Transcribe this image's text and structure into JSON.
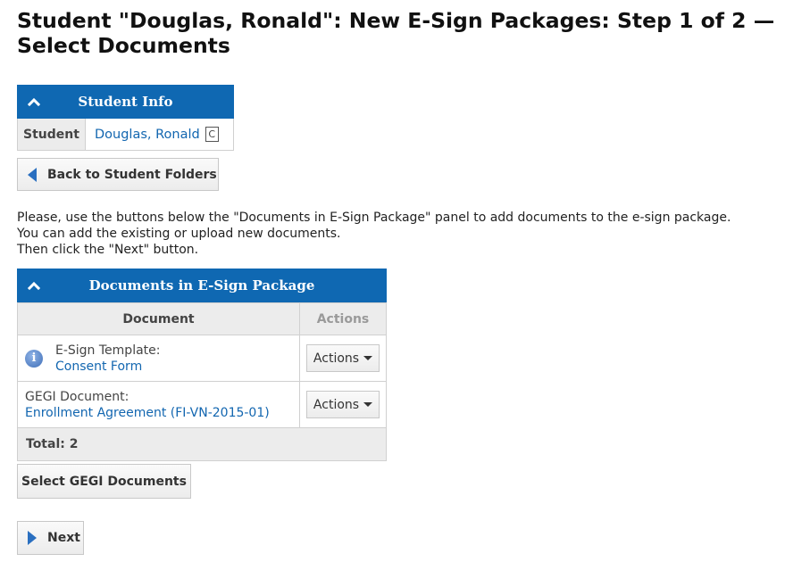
{
  "page": {
    "title": "Student \"Douglas, Ronald\": New E-Sign Packages: Step 1 of 2 — Select Documents"
  },
  "student_panel": {
    "header": "Student Info",
    "collapse_icon": "chevron-up-icon",
    "student_label": "Student",
    "student_name": "Douglas, Ronald",
    "badge": "C"
  },
  "back_button": {
    "label": "Back to Student Folders",
    "icon": "arrow-left-icon"
  },
  "instructions": {
    "line1": "Please, use the buttons below the \"Documents in E-Sign Package\" panel to add documents to the e-sign package.",
    "line2": "You can add the existing or upload new documents.",
    "line3": "Then click the \"Next\" button."
  },
  "documents_panel": {
    "header": "Documents in E-Sign Package",
    "collapse_icon": "chevron-up-icon",
    "columns": {
      "document": "Document",
      "actions": "Actions"
    },
    "rows": [
      {
        "icon": "info-icon",
        "type": "E-Sign Template:",
        "name": "Consent Form",
        "actions_label": "Actions"
      },
      {
        "icon": "",
        "type": "GEGI Document:",
        "name": "Enrollment Agreement (FI-VN-2015-01)",
        "actions_label": "Actions"
      }
    ],
    "total": "Total: 2"
  },
  "select_button": {
    "label": "Select GEGI Documents"
  },
  "next_button": {
    "label": "Next",
    "icon": "arrow-right-icon"
  },
  "colors": {
    "panel_header": "#0f68b2",
    "link": "#1266b0",
    "header_gray": "#ececec"
  }
}
